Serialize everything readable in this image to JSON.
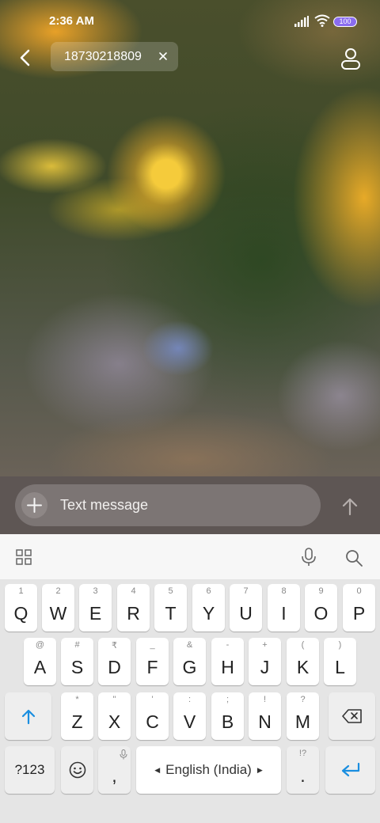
{
  "status_bar": {
    "time": "2:36 AM",
    "battery": "100"
  },
  "header": {
    "recipient": "18730218809"
  },
  "compose": {
    "placeholder": "Text message"
  },
  "keyboard": {
    "row1": [
      {
        "hint": "1",
        "main": "Q"
      },
      {
        "hint": "2",
        "main": "W"
      },
      {
        "hint": "3",
        "main": "E"
      },
      {
        "hint": "4",
        "main": "R"
      },
      {
        "hint": "5",
        "main": "T"
      },
      {
        "hint": "6",
        "main": "Y"
      },
      {
        "hint": "7",
        "main": "U"
      },
      {
        "hint": "8",
        "main": "I"
      },
      {
        "hint": "9",
        "main": "O"
      },
      {
        "hint": "0",
        "main": "P"
      }
    ],
    "row2": [
      {
        "hint": "@",
        "main": "A"
      },
      {
        "hint": "#",
        "main": "S"
      },
      {
        "hint": "₹",
        "main": "D"
      },
      {
        "hint": "_",
        "main": "F"
      },
      {
        "hint": "&",
        "main": "G"
      },
      {
        "hint": "-",
        "main": "H"
      },
      {
        "hint": "+",
        "main": "J"
      },
      {
        "hint": "(",
        "main": "K"
      },
      {
        "hint": ")",
        "main": "L"
      }
    ],
    "row3": [
      {
        "hint": "*",
        "main": "Z"
      },
      {
        "hint": "\"",
        "main": "X"
      },
      {
        "hint": "'",
        "main": "C"
      },
      {
        "hint": ":",
        "main": "V"
      },
      {
        "hint": ";",
        "main": "B"
      },
      {
        "hint": "!",
        "main": "N"
      },
      {
        "hint": "?",
        "main": "M"
      }
    ],
    "symbols_label": "?123",
    "comma": ",",
    "space_label": "English (India)",
    "period": ".",
    "period_hint": "!?"
  }
}
